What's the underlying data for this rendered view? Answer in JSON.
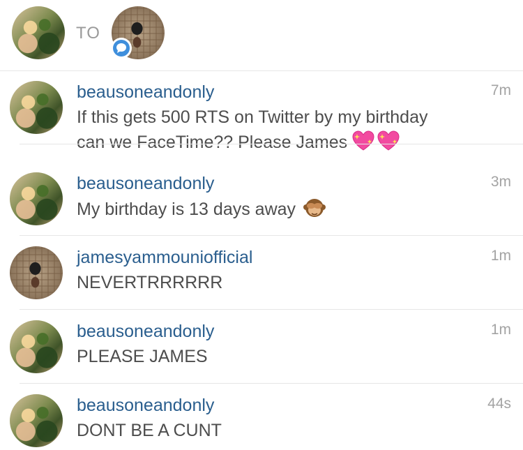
{
  "header": {
    "to_label": "TO",
    "recipient_avatar": "jamesyammouniofficial",
    "badge_icon": "chat-bubble-icon"
  },
  "messages": [
    {
      "username": "beausoneandonly",
      "time": "7m",
      "lines": [
        "If this gets 500 RTS on Twitter by my birthday",
        "can we FaceTime?? Please James"
      ],
      "emoji": [
        "sparkling-heart-icon",
        "sparkling-heart-icon"
      ]
    },
    {
      "username": "beausoneandonly",
      "time": "3m",
      "lines": [
        "My birthday is 13 days away"
      ],
      "emoji": [
        "see-no-evil-monkey-icon"
      ]
    },
    {
      "username": "jamesyammouniofficial",
      "time": "1m",
      "lines": [
        "NEVERTRRRRRR"
      ],
      "emoji": []
    },
    {
      "username": "beausoneandonly",
      "time": "1m",
      "lines": [
        "PLEASE JAMES"
      ],
      "emoji": []
    },
    {
      "username": "beausoneandonly",
      "time": "44s",
      "lines": [
        "DONT BE A CUNT"
      ],
      "emoji": []
    }
  ],
  "colors": {
    "username": "#2a5e8e",
    "text": "#4d4d4d",
    "time": "#a3a3a3",
    "badge": "#3f8fdc"
  }
}
